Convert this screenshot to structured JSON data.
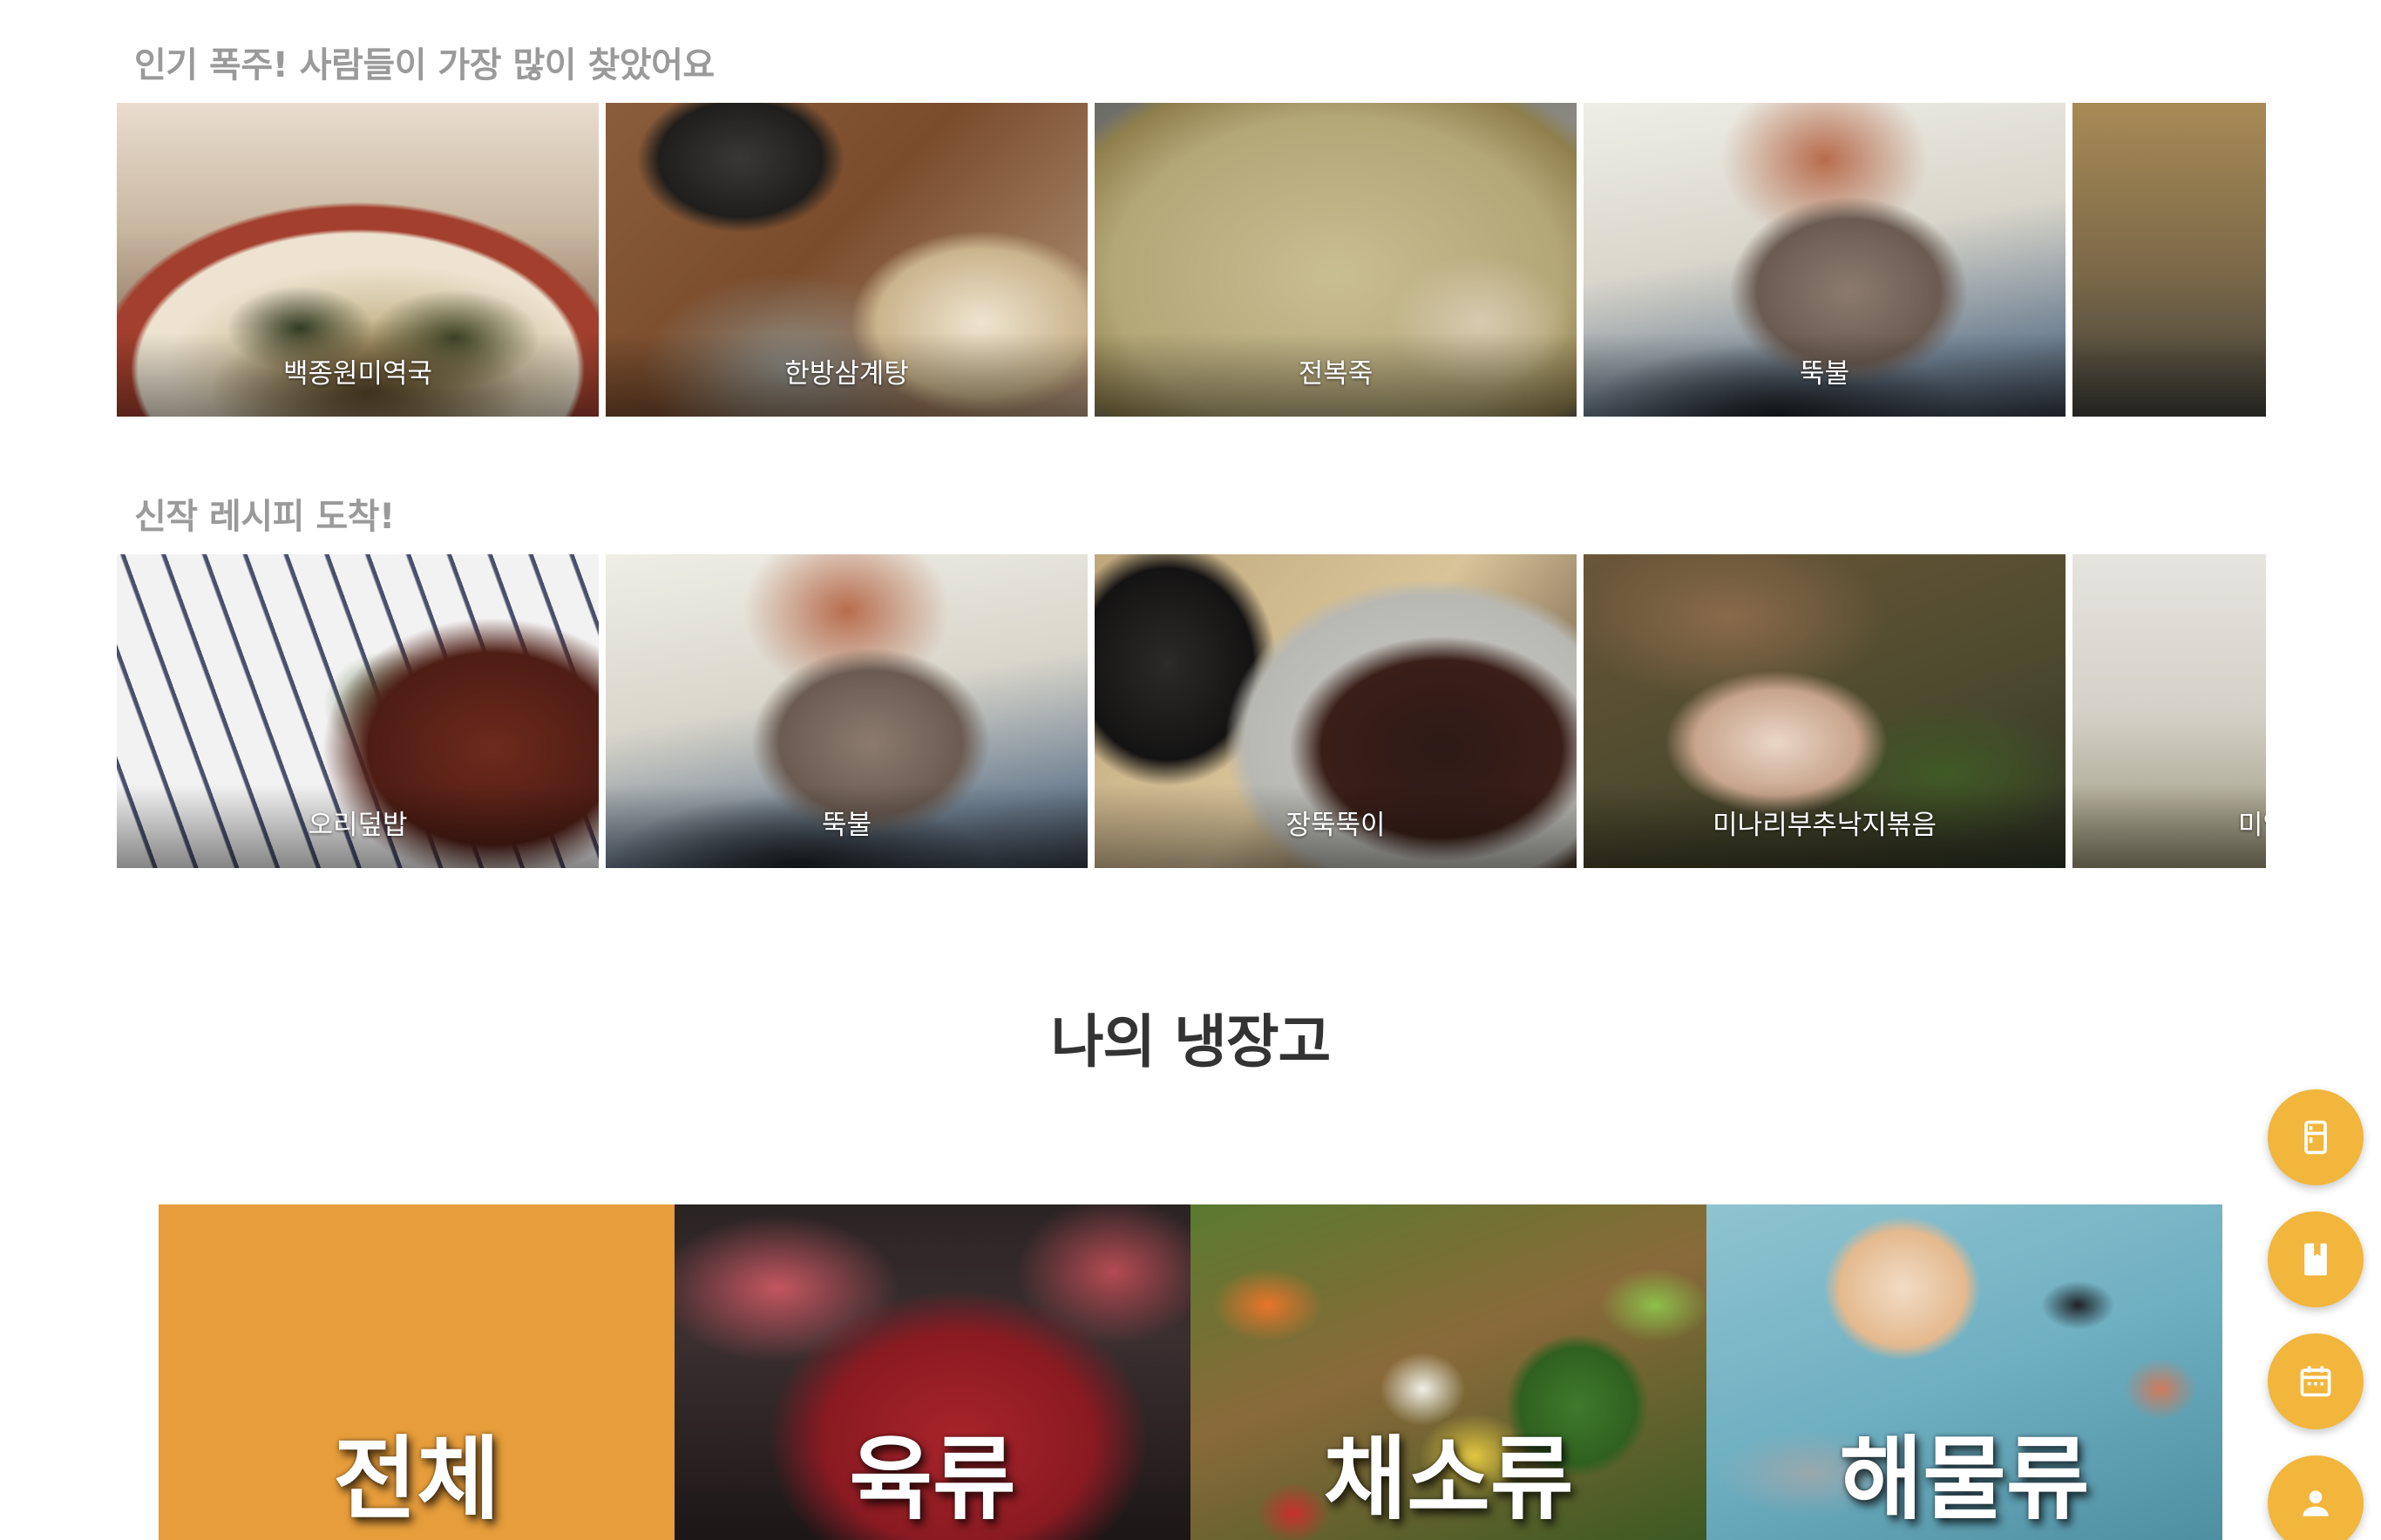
{
  "popular": {
    "title": "인기 폭주! 사람들이 가장 많이 찾았어요",
    "items": [
      {
        "label": "백종원미역국",
        "photo": "seaweed-soup"
      },
      {
        "label": "한방삼계탕",
        "photo": "ginseng-chicken-soup"
      },
      {
        "label": "전복죽",
        "photo": "abalone-porridge"
      },
      {
        "label": "뚝불",
        "photo": "bulgogi-ribs"
      },
      {
        "label": "",
        "photo": "dried-flowers"
      }
    ]
  },
  "new_recipes": {
    "title": "신작 레시피 도착!",
    "items": [
      {
        "label": "오리덮밥",
        "photo": "duck-rice-bowl"
      },
      {
        "label": "뚝불",
        "photo": "bulgogi-ribs"
      },
      {
        "label": "장뚝뚝이",
        "photo": "braised-beef"
      },
      {
        "label": "미나리부추낙지볶음",
        "photo": "octopus-stir-fry"
      },
      {
        "label": "미역",
        "photo": "soup"
      }
    ]
  },
  "fridge": {
    "title": "나의 냉장고",
    "categories": [
      {
        "label": "전체"
      },
      {
        "label": "육류"
      },
      {
        "label": "채소류"
      },
      {
        "label": "해물류"
      }
    ]
  },
  "fab": {
    "color": "#f1b63b",
    "buttons": [
      {
        "icon": "fridge-icon"
      },
      {
        "icon": "book-icon"
      },
      {
        "icon": "calendar-icon"
      },
      {
        "icon": "person-icon"
      }
    ]
  },
  "colors": {
    "accent": "#e79d3b",
    "section_title": "#9a9a9a",
    "heading": "#333333"
  }
}
